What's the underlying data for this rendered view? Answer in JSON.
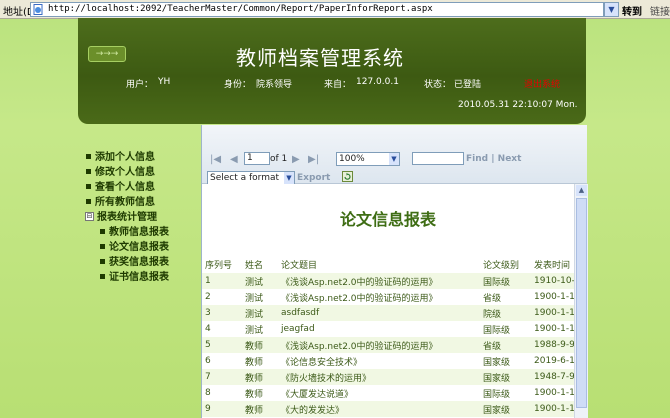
{
  "browser": {
    "address_label": "地址(D)",
    "url": "http://localhost:2092/TeacherMaster/Common/Report/PaperInforReport.aspx",
    "go_label": "转到",
    "links_label": "链接"
  },
  "header": {
    "logo_text": "→→→",
    "title": "教师档案管理系统",
    "user_label": "用户：",
    "user_value": "YH",
    "role_label": "身份：",
    "role_value": "院系领导",
    "from_label": "来自：",
    "from_value": "127.0.0.1",
    "status_label": "状态：",
    "status_value": "已登陆",
    "logout_label": "退出系统",
    "datetime": "2010.05.31  22:10:07  Mon."
  },
  "nav": {
    "items": [
      {
        "label": "添加个人信息"
      },
      {
        "label": "修改个人信息"
      },
      {
        "label": "查看个人信息"
      },
      {
        "label": "所有教师信息"
      }
    ],
    "group": {
      "toggle": "⊟",
      "label": "报表统计管理",
      "children": [
        {
          "label": "教师信息报表"
        },
        {
          "label": "论文信息报表"
        },
        {
          "label": "获奖信息报表"
        },
        {
          "label": "证书信息报表"
        }
      ]
    }
  },
  "toolbar": {
    "page_value": "1",
    "page_of": "of 1",
    "zoom_value": "100%",
    "find_label": "Find",
    "separator": "|",
    "next_label": "Next",
    "format_value": "Select a format",
    "export_label": "Export"
  },
  "report": {
    "title": "论文信息报表",
    "columns": [
      "序列号",
      "姓名",
      "论文题目",
      "论文级别",
      "发表时间"
    ],
    "rows": [
      [
        "1",
        "测试",
        "《浅谈Asp.net2.0中的验证码的运用》",
        "国际级",
        "1910-10-"
      ],
      [
        "2",
        "测试",
        "《浅谈Asp.net2.0中的验证码的运用》",
        "省级",
        "1900-1-1"
      ],
      [
        "3",
        "测试",
        "asdfasdf",
        "院级",
        "1900-1-1"
      ],
      [
        "4",
        "测试",
        "jeagfad",
        "国际级",
        "1900-1-1"
      ],
      [
        "5",
        "教师",
        "《浅谈Asp.net2.0中的验证码的运用》",
        "省级",
        "1988-9-9"
      ],
      [
        "6",
        "教师",
        "《论信息安全技术》",
        "国家级",
        "2019-6-1"
      ],
      [
        "7",
        "教师",
        "《防火墙技术的运用》",
        "国家级",
        "1948-7-9"
      ],
      [
        "8",
        "教师",
        "《大厦发达说道》",
        "国际级",
        "1900-1-1"
      ],
      [
        "9",
        "教师",
        "《大的发发达》",
        "国家级",
        "1900-1-1"
      ]
    ]
  }
}
